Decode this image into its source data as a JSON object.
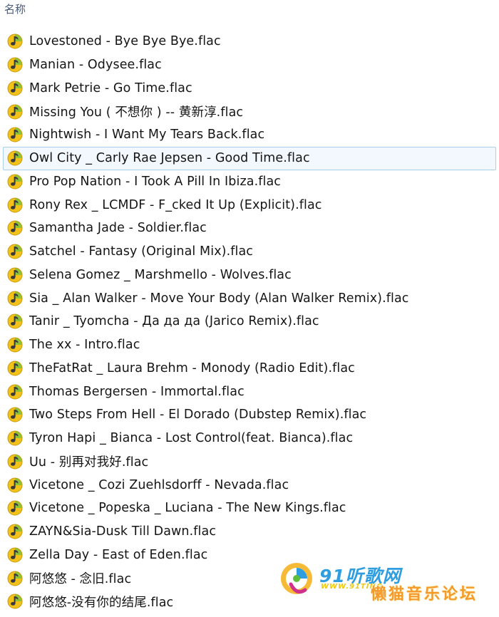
{
  "header": {
    "column_name": "名称"
  },
  "files": [
    {
      "name": "Lovestoned - Bye Bye Bye.flac",
      "selected": false
    },
    {
      "name": "Manian - Odysee.flac",
      "selected": false
    },
    {
      "name": "Mark Petrie - Go Time.flac",
      "selected": false
    },
    {
      "name": "Missing You ( 不想你 ) -- 黄新淳.flac",
      "selected": false
    },
    {
      "name": "Nightwish - I Want My Tears Back.flac",
      "selected": false
    },
    {
      "name": "Owl City _ Carly Rae Jepsen - Good Time.flac",
      "selected": true
    },
    {
      "name": "Pro Pop Nation - I Took A Pill In Ibiza.flac",
      "selected": false
    },
    {
      "name": "Rony Rex _ LCMDF - F_cked It Up (Explicit).flac",
      "selected": false
    },
    {
      "name": "Samantha Jade - Soldier.flac",
      "selected": false
    },
    {
      "name": "Satchel - Fantasy (Original Mix).flac",
      "selected": false
    },
    {
      "name": "Selena Gomez _ Marshmello - Wolves.flac",
      "selected": false
    },
    {
      "name": "Sia _ Alan Walker - Move Your Body (Alan Walker Remix).flac",
      "selected": false
    },
    {
      "name": "Tanir _ Tyomcha - Да да да (Jarico Remix).flac",
      "selected": false
    },
    {
      "name": "The xx - Intro.flac",
      "selected": false
    },
    {
      "name": "TheFatRat _ Laura Brehm - Monody (Radio Edit).flac",
      "selected": false
    },
    {
      "name": "Thomas Bergersen - Immortal.flac",
      "selected": false
    },
    {
      "name": "Two Steps From Hell - El Dorado (Dubstep Remix).flac",
      "selected": false
    },
    {
      "name": "Tyron Hapi _ Bianca - Lost Control(feat. Bianca).flac",
      "selected": false
    },
    {
      "name": "Uu - 别再对我好.flac",
      "selected": false
    },
    {
      "name": "Vicetone _ Cozi Zuehlsdorff - Nevada.flac",
      "selected": false
    },
    {
      "name": "Vicetone _ Popeska _ Luciana - The New Kings.flac",
      "selected": false
    },
    {
      "name": "ZAYN&Sia-Dusk Till Dawn.flac",
      "selected": false
    },
    {
      "name": "Zella Day - East of Eden.flac",
      "selected": false
    },
    {
      "name": "阿悠悠 - 念旧.flac",
      "selected": false
    },
    {
      "name": "阿悠悠-没有你的结尾.flac",
      "selected": false
    }
  ],
  "icons": {
    "file_type_icon": "audio-file-icon",
    "primary_color": "#f2c21b",
    "accent_color": "#5fbf3a"
  },
  "watermark": {
    "brand": "91听歌网",
    "url": "WWW.91TING",
    "forum": "懒猫音乐论坛"
  }
}
